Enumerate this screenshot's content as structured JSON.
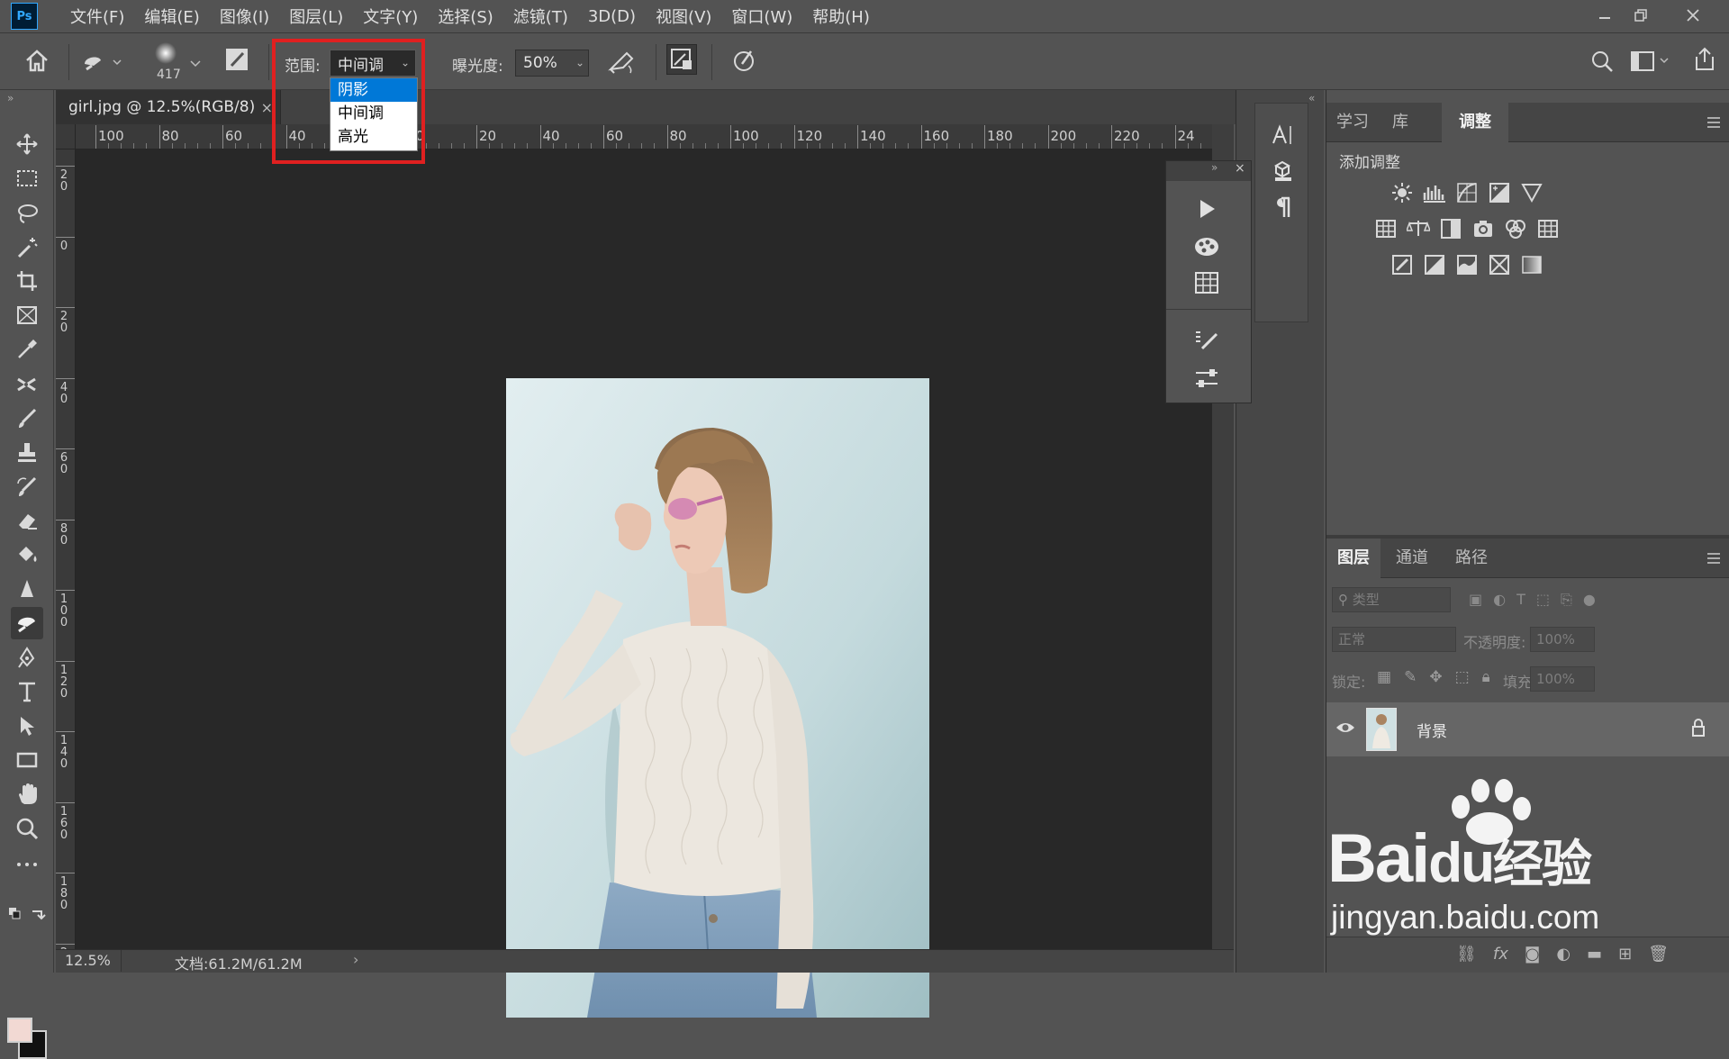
{
  "app": {
    "logo": "Ps"
  },
  "menu": [
    "文件(F)",
    "编辑(E)",
    "图像(I)",
    "图层(L)",
    "文字(Y)",
    "选择(S)",
    "滤镜(T)",
    "3D(D)",
    "视图(V)",
    "窗口(W)",
    "帮助(H)"
  ],
  "options": {
    "brush_size": "417",
    "range_label": "范围:",
    "range_value": "中间调",
    "range_options": [
      "阴影",
      "中间调",
      "高光"
    ],
    "range_selected_index": 0,
    "exposure_label": "曝光度:",
    "exposure_value": "50%"
  },
  "document": {
    "tab_title": "girl.jpg @ 12.5%(RGB/8)",
    "close_symbol": "×",
    "zoom": "12.5%",
    "doc_info": "文档:61.2M/61.2M",
    "hruler_labels": [
      "100",
      "80",
      "60",
      "40",
      "20",
      "0",
      "20",
      "40",
      "60",
      "80",
      "100",
      "120",
      "140",
      "160",
      "180",
      "200",
      "220",
      "24"
    ],
    "vruler_labels": [
      [
        "2",
        "0"
      ],
      [
        "0"
      ],
      [
        "2",
        "0"
      ],
      [
        "4",
        "0"
      ],
      [
        "6",
        "0"
      ],
      [
        "8",
        "0"
      ],
      [
        "1",
        "0",
        "0"
      ],
      [
        "1",
        "2",
        "0"
      ],
      [
        "1",
        "4",
        "0"
      ],
      [
        "1",
        "6",
        "0"
      ],
      [
        "1",
        "8",
        "0"
      ],
      [
        "2",
        "0",
        "0"
      ],
      [
        "2",
        "2",
        "0"
      ]
    ]
  },
  "panels": {
    "top_tabs": [
      "学习",
      "库",
      "调整"
    ],
    "top_active": "调整",
    "add_adjustment": "添加调整",
    "layer_tabs": [
      "图层",
      "通道",
      "路径"
    ],
    "layer_active": "图层",
    "filter_placeholder": "类型",
    "blend_mode": "正常",
    "opacity_label": "不透明度:",
    "opacity_value": "100%",
    "lock_label": "锁定:",
    "fill_label": "填充:",
    "fill_value": "100%",
    "layer_name": "背景"
  },
  "watermark": {
    "brand": "Bai",
    "brand2": "du",
    "cn": "经验",
    "url": "jingyan.baidu.com"
  },
  "colors": {
    "accent": "#0078d7",
    "highlight_frame": "#e02020",
    "ps_blue": "#31a8ff"
  }
}
